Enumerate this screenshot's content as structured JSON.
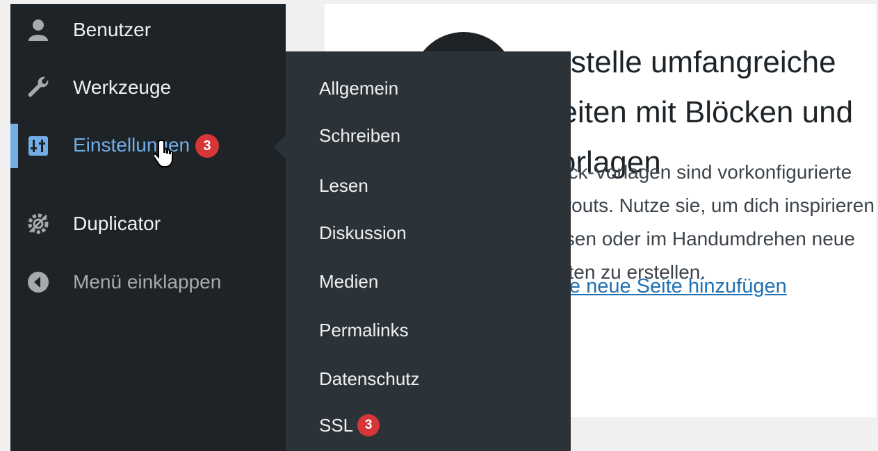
{
  "sidebar": {
    "items": [
      {
        "label": "Benutzer",
        "icon": "users-icon"
      },
      {
        "label": "Werkzeuge",
        "icon": "wrench-icon"
      },
      {
        "label": "Einstellungen",
        "icon": "settings-sliders-icon",
        "badge": "3",
        "current": true
      },
      {
        "label": "Duplicator",
        "icon": "duplicator-gear-icon"
      },
      {
        "label": "Menü einklappen",
        "icon": "collapse-arrow-icon"
      }
    ]
  },
  "submenu": {
    "items": [
      {
        "label": "Allgemein"
      },
      {
        "label": "Schreiben"
      },
      {
        "label": "Lesen"
      },
      {
        "label": "Diskussion"
      },
      {
        "label": "Medien"
      },
      {
        "label": "Permalinks"
      },
      {
        "label": "Datenschutz"
      },
      {
        "label": "SSL",
        "badge": "3"
      }
    ]
  },
  "content": {
    "heading": "Erstelle umfangreiche Seiten mit Blöcken und Vorlagen",
    "description": "Block-Vorlagen sind vorkonfigurierte Layouts. Nutze sie, um dich inspirieren zu lassen oder im Handumdrehen neue Seiten zu erstellen.",
    "link": "Eine neue Seite hinzufügen"
  },
  "colors": {
    "sidebar_bg": "#1d2327",
    "submenu_bg": "#2c3338",
    "accent": "#72aee6",
    "badge": "#d63638",
    "link": "#2271b1"
  }
}
